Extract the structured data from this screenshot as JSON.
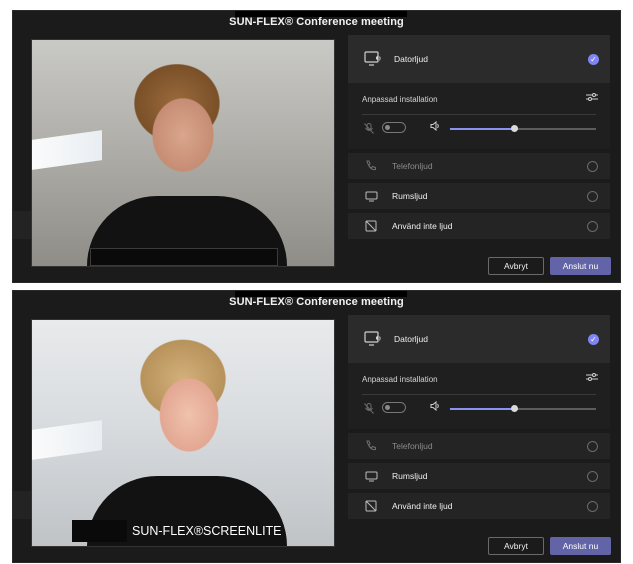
{
  "panels": [
    {
      "title": "SUN-FLEX® Conference meeting",
      "name_overlay": "",
      "options": {
        "selected": {
          "label": "Datorljud",
          "icon": "computer-audio-icon",
          "checked": true
        },
        "custom": {
          "label": "Anpassad installation",
          "icon": "settings-sliders-icon",
          "mic_muted": true,
          "volume_fraction": 0.44
        },
        "others": [
          {
            "label": "Telefonljud",
            "icon": "phone-icon",
            "disabled": true
          },
          {
            "label": "Rumsljud",
            "icon": "room-audio-icon",
            "disabled": false
          },
          {
            "label": "Använd inte ljud",
            "icon": "no-audio-icon",
            "disabled": false
          }
        ]
      },
      "buttons": {
        "cancel": "Avbryt",
        "join": "Anslut nu"
      }
    },
    {
      "title": "SUN-FLEX® Conference meeting",
      "name_overlay": "SUN-FLEX®SCREENLITE",
      "options": {
        "selected": {
          "label": "Datorljud",
          "icon": "computer-audio-icon",
          "checked": true
        },
        "custom": {
          "label": "Anpassad installation",
          "icon": "settings-sliders-icon",
          "mic_muted": true,
          "volume_fraction": 0.44
        },
        "others": [
          {
            "label": "Telefonljud",
            "icon": "phone-icon",
            "disabled": true
          },
          {
            "label": "Rumsljud",
            "icon": "room-audio-icon",
            "disabled": false
          },
          {
            "label": "Använd inte ljud",
            "icon": "no-audio-icon",
            "disabled": false
          }
        ]
      },
      "buttons": {
        "cancel": "Avbryt",
        "join": "Anslut nu"
      }
    }
  ],
  "colors": {
    "accent": "#6264a7",
    "check": "#7f85f5",
    "panel_bg": "#1b1b1b"
  }
}
